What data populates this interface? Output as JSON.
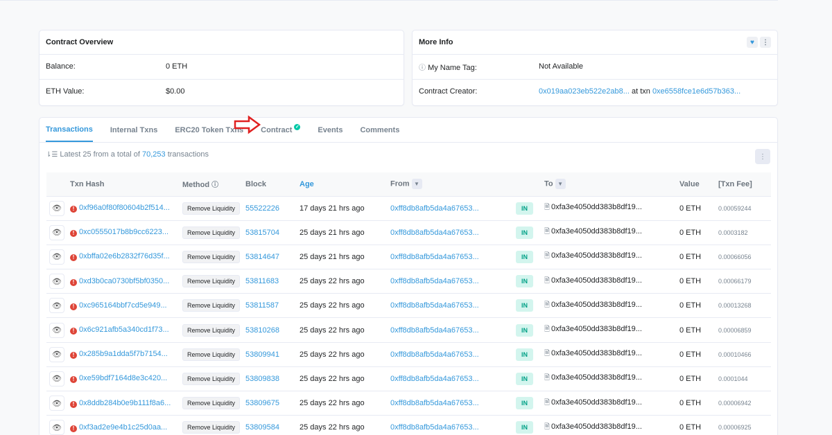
{
  "overview": {
    "title": "Contract Overview",
    "rows": [
      {
        "label": "Balance:",
        "value": "0 ETH"
      },
      {
        "label": "ETH Value:",
        "value": "$0.00"
      }
    ]
  },
  "more_info": {
    "title": "More Info",
    "name_tag_label": "My Name Tag:",
    "name_tag_value": "Not Available",
    "creator_label": "Contract Creator:",
    "creator_address": "0x019aa023eb522e2ab8...",
    "creator_at_txn": "at txn",
    "creator_txn": "0xe6558fce1e6d57b363..."
  },
  "tabs": [
    {
      "label": "Transactions",
      "active": true
    },
    {
      "label": "Internal Txns"
    },
    {
      "label": "ERC20 Token Txns"
    },
    {
      "label": "Contract",
      "verified": true
    },
    {
      "label": "Events"
    },
    {
      "label": "Comments"
    }
  ],
  "summary": {
    "prefix": "Latest 25 from a total of",
    "total": "70,253",
    "suffix": "transactions"
  },
  "columns": {
    "hash": "Txn Hash",
    "method": "Method",
    "block": "Block",
    "age": "Age",
    "from": "From",
    "to": "To",
    "value": "Value",
    "fee": "[Txn Fee]"
  },
  "rows": [
    {
      "hash": "0xf96a0f80f80604b2f514...",
      "method": "Remove Liquidity",
      "block": "55522226",
      "age": "17 days 21 hrs ago",
      "from": "0xff8db8afb5da4a67653...",
      "dir": "IN",
      "to": "0xfa3e4050dd383b8df19...",
      "value": "0 ETH",
      "fee": "0.00059244"
    },
    {
      "hash": "0xc0555017b8b9cc6223...",
      "method": "Remove Liquidity",
      "block": "53815704",
      "age": "25 days 21 hrs ago",
      "from": "0xff8db8afb5da4a67653...",
      "dir": "IN",
      "to": "0xfa3e4050dd383b8df19...",
      "value": "0 ETH",
      "fee": "0.0003182"
    },
    {
      "hash": "0xbffa02e6b2832f76d35f...",
      "method": "Remove Liquidity",
      "block": "53814647",
      "age": "25 days 21 hrs ago",
      "from": "0xff8db8afb5da4a67653...",
      "dir": "IN",
      "to": "0xfa3e4050dd383b8df19...",
      "value": "0 ETH",
      "fee": "0.00066056"
    },
    {
      "hash": "0xd3b0ca0730bf5bf0350...",
      "method": "Remove Liquidity",
      "block": "53811683",
      "age": "25 days 22 hrs ago",
      "from": "0xff8db8afb5da4a67653...",
      "dir": "IN",
      "to": "0xfa3e4050dd383b8df19...",
      "value": "0 ETH",
      "fee": "0.00066179"
    },
    {
      "hash": "0xc965164bbf7cd5e949...",
      "method": "Remove Liquidity",
      "block": "53811587",
      "age": "25 days 22 hrs ago",
      "from": "0xff8db8afb5da4a67653...",
      "dir": "IN",
      "to": "0xfa3e4050dd383b8df19...",
      "value": "0 ETH",
      "fee": "0.00013268"
    },
    {
      "hash": "0x6c921afb5a340cd1f73...",
      "method": "Remove Liquidity",
      "block": "53810268",
      "age": "25 days 22 hrs ago",
      "from": "0xff8db8afb5da4a67653...",
      "dir": "IN",
      "to": "0xfa3e4050dd383b8df19...",
      "value": "0 ETH",
      "fee": "0.00006859"
    },
    {
      "hash": "0x285b9a1dda5f7b7154...",
      "method": "Remove Liquidity",
      "block": "53809941",
      "age": "25 days 22 hrs ago",
      "from": "0xff8db8afb5da4a67653...",
      "dir": "IN",
      "to": "0xfa3e4050dd383b8df19...",
      "value": "0 ETH",
      "fee": "0.00010466"
    },
    {
      "hash": "0xe59bdf7164d8e3c420...",
      "method": "Remove Liquidity",
      "block": "53809838",
      "age": "25 days 22 hrs ago",
      "from": "0xff8db8afb5da4a67653...",
      "dir": "IN",
      "to": "0xfa3e4050dd383b8df19...",
      "value": "0 ETH",
      "fee": "0.0001044"
    },
    {
      "hash": "0x8ddb284b0e9b111f8a6...",
      "method": "Remove Liquidity",
      "block": "53809675",
      "age": "25 days 22 hrs ago",
      "from": "0xff8db8afb5da4a67653...",
      "dir": "IN",
      "to": "0xfa3e4050dd383b8df19...",
      "value": "0 ETH",
      "fee": "0.00006942"
    },
    {
      "hash": "0xf3ad2e9e4b1c25d0aa...",
      "method": "Remove Liquidity",
      "block": "53809584",
      "age": "25 days 22 hrs ago",
      "from": "0xff8db8afb5da4a67653...",
      "dir": "IN",
      "to": "0xfa3e4050dd383b8df19...",
      "value": "0 ETH",
      "fee": "0.00006925"
    }
  ],
  "colors": {
    "link": "#3498db",
    "error": "#de4437",
    "in_badge": "#00a186",
    "annotation_arrow": "#e02020"
  }
}
